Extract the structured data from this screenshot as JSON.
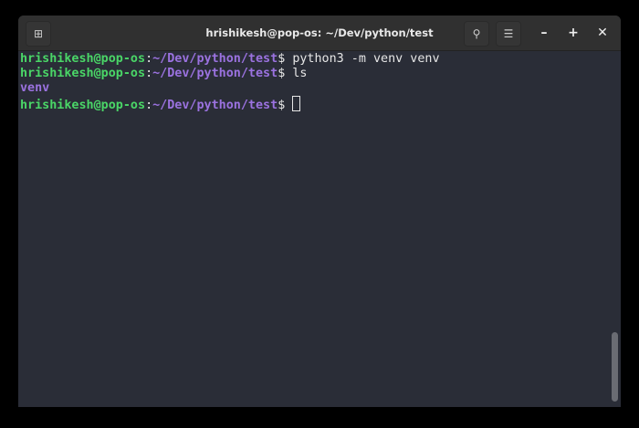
{
  "window": {
    "title": "hrishikesh@pop-os: ~/Dev/python/test"
  },
  "prompt": {
    "user": "hrishikesh@pop-os",
    "sep": ":",
    "path": "~/Dev/python/test",
    "symbol": "$ "
  },
  "lines": [
    {
      "command": "python3 -m venv venv"
    },
    {
      "command": "ls"
    },
    {
      "output": "venv"
    },
    {
      "command": ""
    }
  ],
  "colors": {
    "user": "#4ad667",
    "path": "#9b72e0",
    "background": "#2a2d37"
  }
}
